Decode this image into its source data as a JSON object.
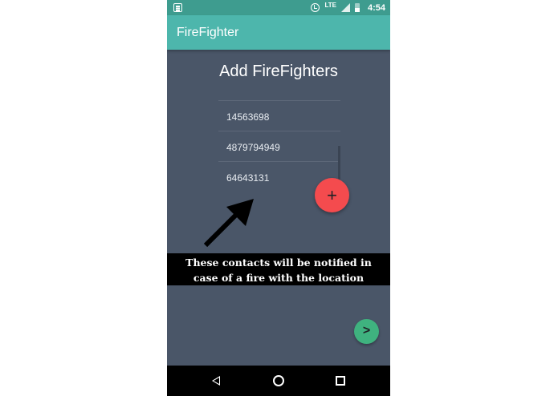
{
  "status_bar": {
    "network": "LTE",
    "time": "4:54"
  },
  "app_bar": {
    "title": "FireFighter"
  },
  "screen": {
    "title": "Add FireFighters"
  },
  "contacts": [
    "14563698",
    "4879794949",
    "64643131"
  ],
  "add_button": {
    "label": "+"
  },
  "next_button": {
    "label": ">"
  },
  "caption": {
    "line1": "These contacts will be notified in",
    "line2": "case of a fire with the location"
  },
  "colors": {
    "status_bar": "#3e9c8f",
    "app_bar": "#4db6ac",
    "background": "#4a5668",
    "add_fab": "#f44b4e",
    "next_fab": "#3fb27f"
  },
  "icons": {
    "notification": "notification-icon",
    "sync": "sync-icon",
    "signal": "signal-icon",
    "battery": "battery-icon",
    "nav_back": "back-icon",
    "nav_home": "home-icon",
    "nav_recent": "recent-apps-icon"
  }
}
